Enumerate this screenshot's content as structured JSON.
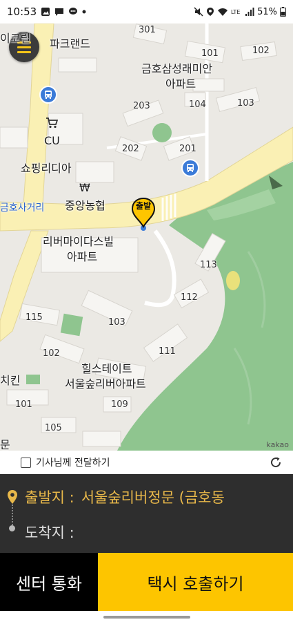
{
  "status_bar": {
    "time": "10:53",
    "battery": "51%",
    "left_icons": [
      "image-icon",
      "message-icon",
      "chat-icon",
      "dot-icon"
    ],
    "right_icons": [
      "mute-icon",
      "location-icon",
      "wifi-icon",
      "lte-icon",
      "signal-icon",
      "battery-icon"
    ]
  },
  "map": {
    "labels": {
      "park_land": "파크랜드",
      "cu": "CU",
      "shopping_media": "쇼핑리디아",
      "nonghyup": "중앙농협",
      "geumho_intersection": "금호사거리",
      "rivermaidas": "리버마이다스빌",
      "rivermaidas_apt": "아파트",
      "raemian": "금호삼성래미안",
      "raemian_apt": "아파트",
      "hillstate": "힐스테이트",
      "seoul_forest": "서울숲리버아파트",
      "chicken": "치킨",
      "partial_top": "이코릴",
      "partial_bottom": "문",
      "kakao": "kakao"
    },
    "building_numbers": [
      "301",
      "101",
      "102",
      "203",
      "104",
      "103",
      "202",
      "201",
      "113",
      "112",
      "115",
      "103",
      "102",
      "111",
      "101",
      "109",
      "105"
    ],
    "marker_label": "출발"
  },
  "options": {
    "deliver_to_driver": "기사님께 전달하기",
    "checked": false
  },
  "location": {
    "start_label": "출발지 :",
    "start_value": "서울숲리버정문 (금호동",
    "dest_label": "도착지 :",
    "dest_value": ""
  },
  "buttons": {
    "center_call": "센터 통화",
    "call_taxi": "택시 호출하기"
  },
  "colors": {
    "accent": "#fdc500",
    "panel": "#2e2e2e",
    "start_text": "#e8b84a",
    "park_green": "#84c18a",
    "road_yellow": "#faf0b4"
  }
}
